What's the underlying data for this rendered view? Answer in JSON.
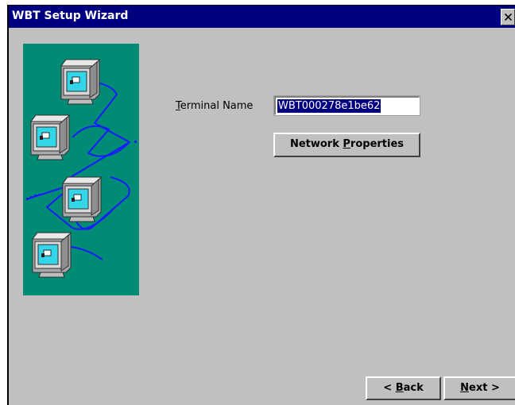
{
  "window": {
    "title": "WBT Setup Wizard"
  },
  "icons": {
    "close": "close-icon",
    "wizard_image": "networked-computers-illustration"
  },
  "form": {
    "terminal_name_label": {
      "mnemonic": "T",
      "rest": "erminal Name"
    },
    "terminal_name_value": "WBT000278e1be62"
  },
  "buttons": {
    "network_properties": {
      "before": "Network ",
      "mnemonic": "P",
      "after": "roperties"
    },
    "back": {
      "before": "< ",
      "mnemonic": "B",
      "after": "ack"
    },
    "next": {
      "before": "",
      "mnemonic": "N",
      "after": "ext >"
    }
  },
  "colors": {
    "titlebar": "#000080",
    "dialog_face": "#c0c0c0",
    "wizard_image_bg": "#008b74",
    "network_line": "#1a1aff",
    "selection": "#000080"
  }
}
